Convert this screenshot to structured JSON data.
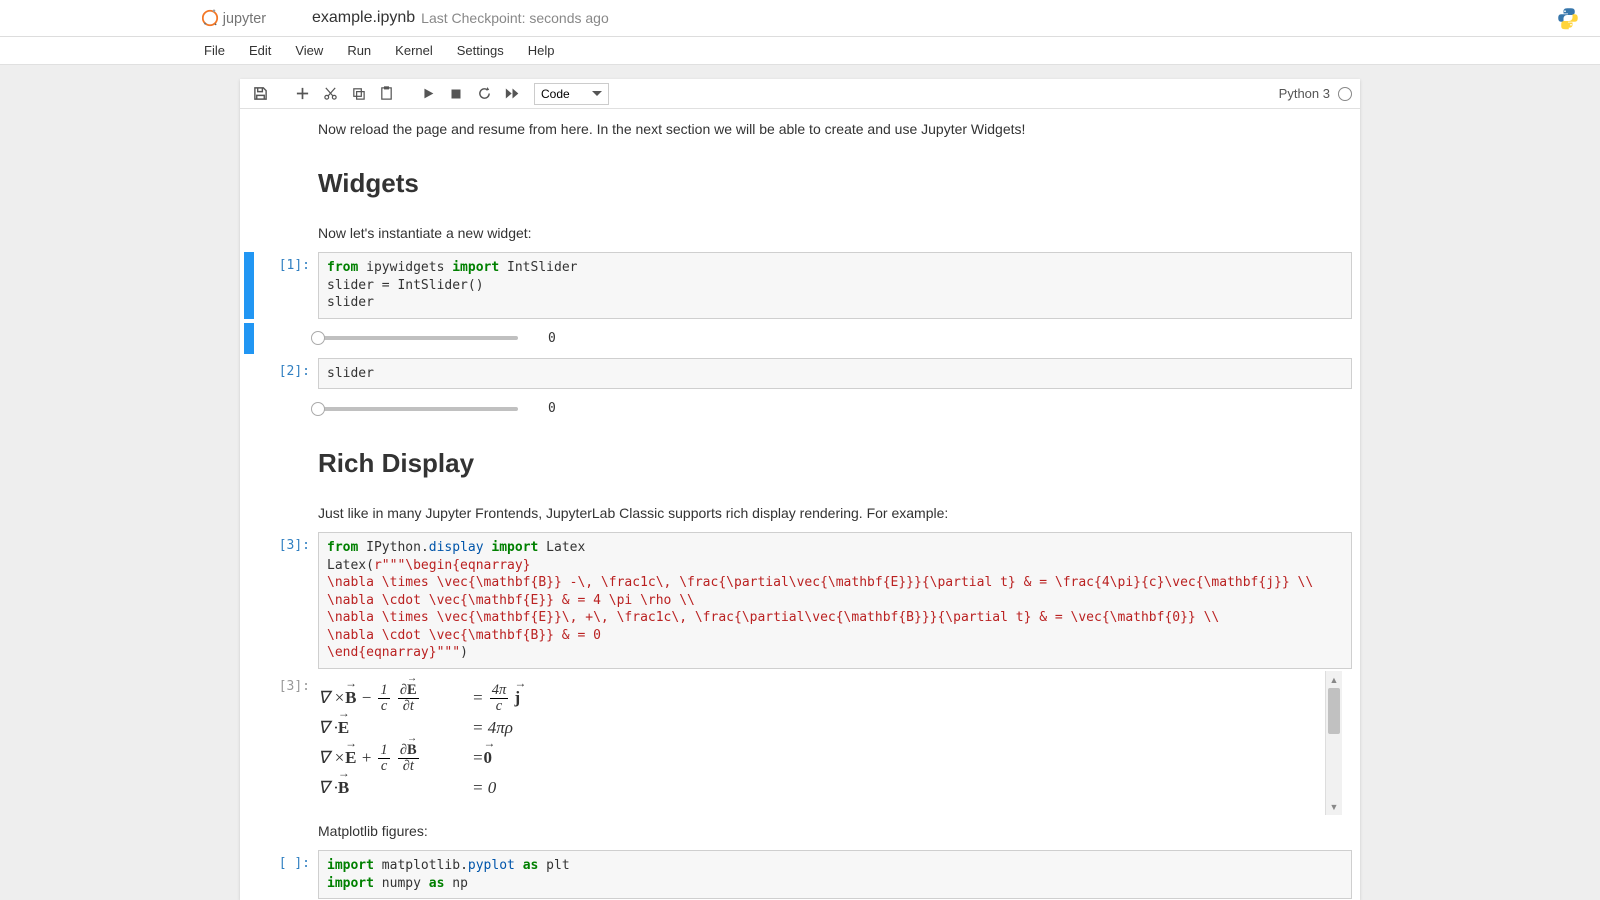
{
  "header": {
    "filename": "example.ipynb",
    "checkpoint": "Last Checkpoint: seconds ago"
  },
  "menu": [
    "File",
    "Edit",
    "View",
    "Run",
    "Kernel",
    "Settings",
    "Help"
  ],
  "toolbar": {
    "cell_type": "Code",
    "kernel_name": "Python 3"
  },
  "cells": {
    "md_reload": "Now reload the page and resume from here. In the next section we will be able to create and use Jupyter Widgets!",
    "h_widgets": "Widgets",
    "md_instantiate": "Now let's instantiate a new widget:",
    "c1_prompt": "[1]:",
    "c1_code_l1a": "from",
    "c1_code_l1b": " ipywidgets ",
    "c1_code_l1c": "import",
    "c1_code_l1d": " IntSlider",
    "c1_code_l2": "slider = IntSlider()",
    "c1_code_l3": "slider",
    "c1_slider_value": "0",
    "c2_prompt": "[2]:",
    "c2_code": "slider",
    "c2_slider_value": "0",
    "h_rich": "Rich Display",
    "md_rich": "Just like in many Jupyter Frontends, JupyterLab Classic supports rich display rendering. For example:",
    "c3_prompt": "[3]:",
    "c3_out_prompt": "[3]:",
    "c3_code_l1a": "from",
    "c3_code_l1b": " IPython",
    "c3_code_l1c": ".",
    "c3_code_l1d": "display",
    "c3_code_l1e": " ",
    "c3_code_l1f": "import",
    "c3_code_l1g": " Latex",
    "c3_code_l2a": "Latex(",
    "c3_code_l2b": "r\"\"\"\\begin{eqnarray}",
    "c3_code_l3": "\\nabla \\times \\vec{\\mathbf{B}} -\\, \\frac1c\\, \\frac{\\partial\\vec{\\mathbf{E}}}{\\partial t} & = \\frac{4\\pi}{c}\\vec{\\mathbf{j}} \\\\",
    "c3_code_l4": "\\nabla \\cdot \\vec{\\mathbf{E}} & = 4 \\pi \\rho \\\\",
    "c3_code_l5": "\\nabla \\times \\vec{\\mathbf{E}}\\, +\\, \\frac1c\\, \\frac{\\partial\\vec{\\mathbf{B}}}{\\partial t} & = \\vec{\\mathbf{0}} \\\\",
    "c3_code_l6": "\\nabla \\cdot \\vec{\\mathbf{B}} & = 0",
    "c3_code_l7a": "\\end{eqnarray}\"\"\"",
    "c3_code_l7b": ")",
    "md_mpl": "Matplotlib figures:",
    "c4_prompt": "[ ]:",
    "c4_code_l1a": "import",
    "c4_code_l1b": " matplotlib",
    "c4_code_l1c": ".",
    "c4_code_l1d": "pyplot",
    "c4_code_l1e": " ",
    "c4_code_l1f": "as",
    "c4_code_l1g": " plt",
    "c4_code_l2a": "import",
    "c4_code_l2b": " numpy ",
    "c4_code_l2c": "as",
    "c4_code_l2d": " np"
  }
}
